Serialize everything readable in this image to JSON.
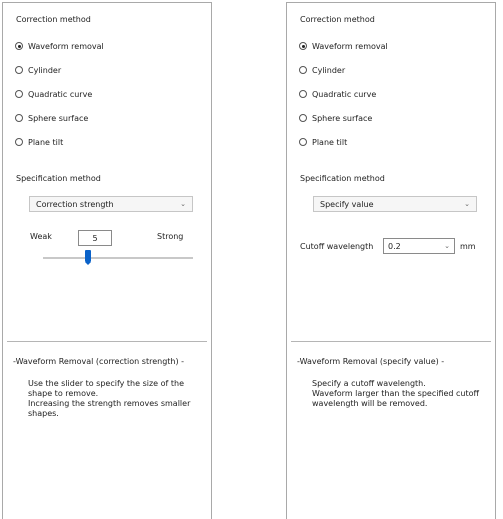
{
  "left_panel": {
    "correction_method_label": "Correction method",
    "options": [
      {
        "label": "Waveform removal",
        "selected": true
      },
      {
        "label": "Cylinder",
        "selected": false
      },
      {
        "label": "Quadratic curve",
        "selected": false
      },
      {
        "label": "Sphere surface",
        "selected": false
      },
      {
        "label": "Plane tilt",
        "selected": false
      }
    ],
    "specification_method_label": "Specification method",
    "specification_value": "Correction strength",
    "slider": {
      "min_label": "Weak",
      "max_label": "Strong",
      "value": "5",
      "level": 0.3
    },
    "description_title": "-Waveform Removal (correction strength) -",
    "description_lines": [
      "Use the slider to specify the size of the",
      "shape to remove.",
      "Increasing the strength removes smaller",
      "shapes."
    ]
  },
  "right_panel": {
    "correction_method_label": "Correction method",
    "options": [
      {
        "label": "Waveform removal",
        "selected": true
      },
      {
        "label": "Cylinder",
        "selected": false
      },
      {
        "label": "Quadratic curve",
        "selected": false
      },
      {
        "label": "Sphere surface",
        "selected": false
      },
      {
        "label": "Plane tilt",
        "selected": false
      }
    ],
    "specification_method_label": "Specification method",
    "specification_value": "Specify value",
    "cutoff": {
      "label": "Cutoff wavelength",
      "value": "0.2",
      "unit": "mm"
    },
    "description_title": "-Waveform Removal (specify value) -",
    "description_lines": [
      "Specify a cutoff wavelength.",
      "Waveform larger than the specified cutoff",
      "wavelength will be removed."
    ]
  }
}
